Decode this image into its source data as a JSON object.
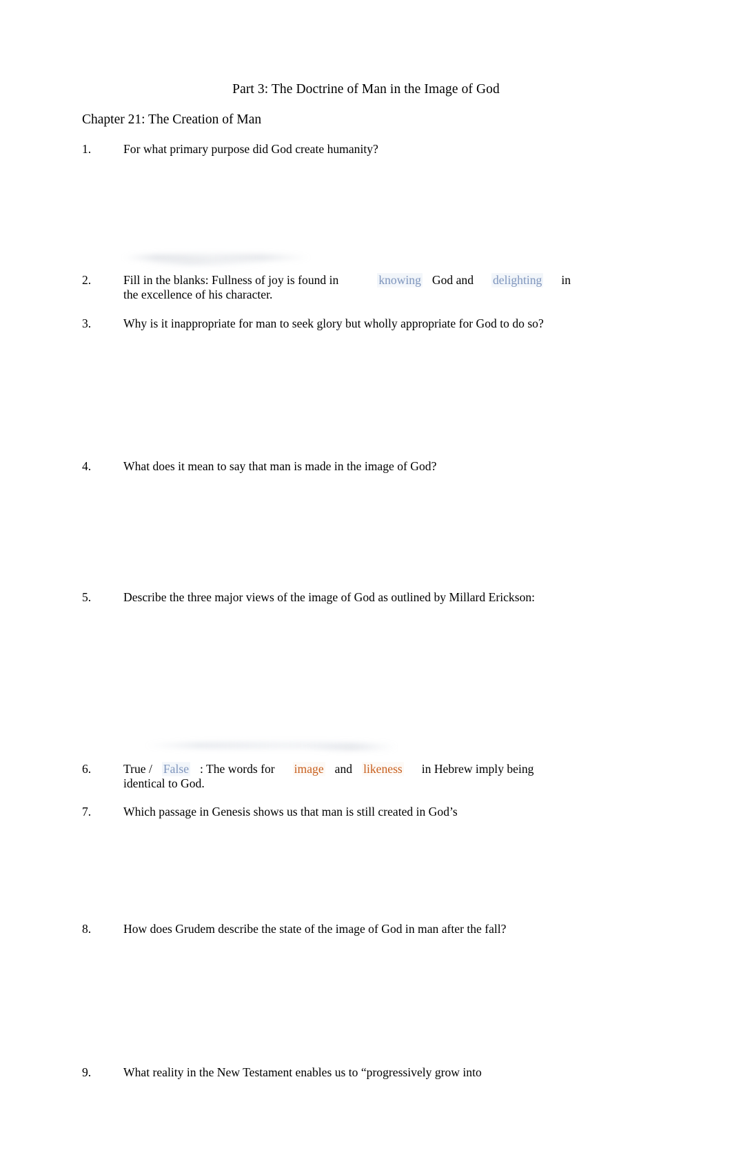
{
  "document": {
    "title": "Part 3: The Doctrine of Man in the Image of God",
    "chapter": "Chapter 21: The Creation of Man"
  },
  "colors": {
    "answer_blue": "#8096bd",
    "answer_orange": "#c8601f",
    "text": "#000000",
    "page_background": "#ffffff"
  },
  "questions": [
    {
      "number": "1.",
      "text": "For what primary purpose did God create humanity?"
    },
    {
      "number": "2.",
      "prompt": "Fill in the blanks: Fullness of joy is found in",
      "answer_1": "knowing",
      "middle": "God and",
      "answer_2": "delighting",
      "tail": "in",
      "continuation": "the excellence of his character."
    },
    {
      "number": "3.",
      "text": "Why is it inappropriate for man to seek glory but wholly appropriate for God to do so?"
    },
    {
      "number": "4.",
      "text": "What does it mean to say that man is made in the image of God?"
    },
    {
      "number": "5.",
      "text": "Describe the three major views of the image of God as outlined by Millard Erickson:"
    },
    {
      "number": "6.",
      "lead": "True /",
      "answer_1": "False",
      "middle_1": ": The words for",
      "answer_2": "image",
      "middle_2": "and",
      "answer_3": "likeness",
      "tail": "in Hebrew imply being",
      "continuation": "identical to God."
    },
    {
      "number": "7.",
      "text": "Which passage in Genesis shows us that man is still created in God’s"
    },
    {
      "number": "8.",
      "text": "How does Grudem describe the state of the image of God in man after the fall?"
    },
    {
      "number": "9.",
      "text": "What reality in the New Testament enables us to “progressively grow into"
    }
  ]
}
